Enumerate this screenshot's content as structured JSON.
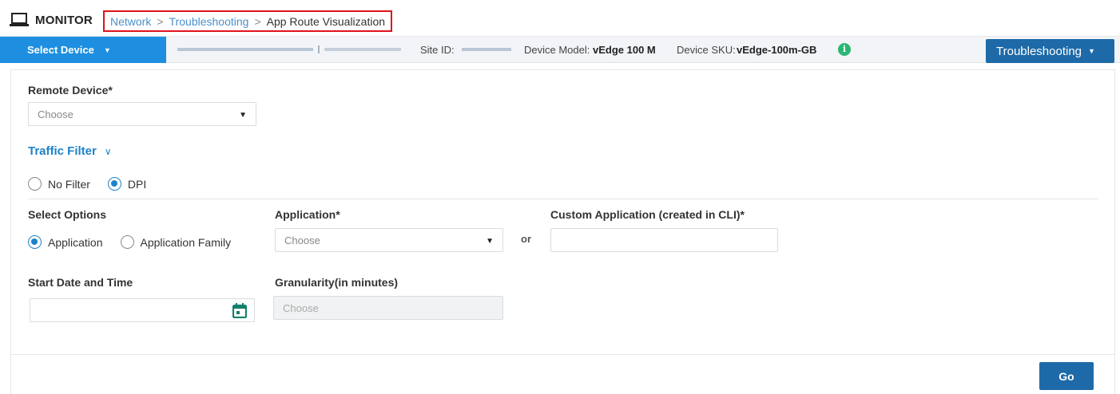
{
  "header": {
    "title": "MONITOR",
    "icon": "monitor-icon",
    "breadcrumb": {
      "items": [
        "Network",
        "Troubleshooting"
      ],
      "separator": ">",
      "current": "App Route Visualization"
    }
  },
  "device_bar": {
    "select_device_label": "Select Device",
    "site_id_label": "Site ID:",
    "device_model_label": "Device Model:",
    "device_model_value": "vEdge 100 M",
    "device_sku_label": "Device SKU:",
    "device_sku_value": "vEdge-100m-GB",
    "info_icon": "info-icon",
    "troubleshooting_button": "Troubleshooting"
  },
  "form": {
    "remote_device": {
      "label": "Remote Device*",
      "placeholder": "Choose"
    },
    "traffic_filter": {
      "label": "Traffic Filter"
    },
    "filter_options": [
      {
        "label": "No Filter",
        "selected": false
      },
      {
        "label": "DPI",
        "selected": true
      }
    ],
    "select_options": {
      "label": "Select Options",
      "options": [
        {
          "label": "Application",
          "selected": true
        },
        {
          "label": "Application Family",
          "selected": false
        }
      ]
    },
    "application": {
      "label": "Application*",
      "placeholder": "Choose"
    },
    "or_text": "or",
    "custom_application": {
      "label": "Custom Application (created in CLI)*",
      "value": ""
    },
    "start_date_time": {
      "label": "Start Date and Time",
      "value": ""
    },
    "granularity": {
      "label": "Granularity(in minutes)",
      "placeholder": "Choose"
    },
    "go_button": "Go"
  },
  "colors": {
    "accent_blue": "#1e8fe0",
    "button_blue": "#1e6aa8",
    "link_blue": "#4a90c9",
    "highlight_red": "#e0121b",
    "info_green": "#2bb673"
  }
}
